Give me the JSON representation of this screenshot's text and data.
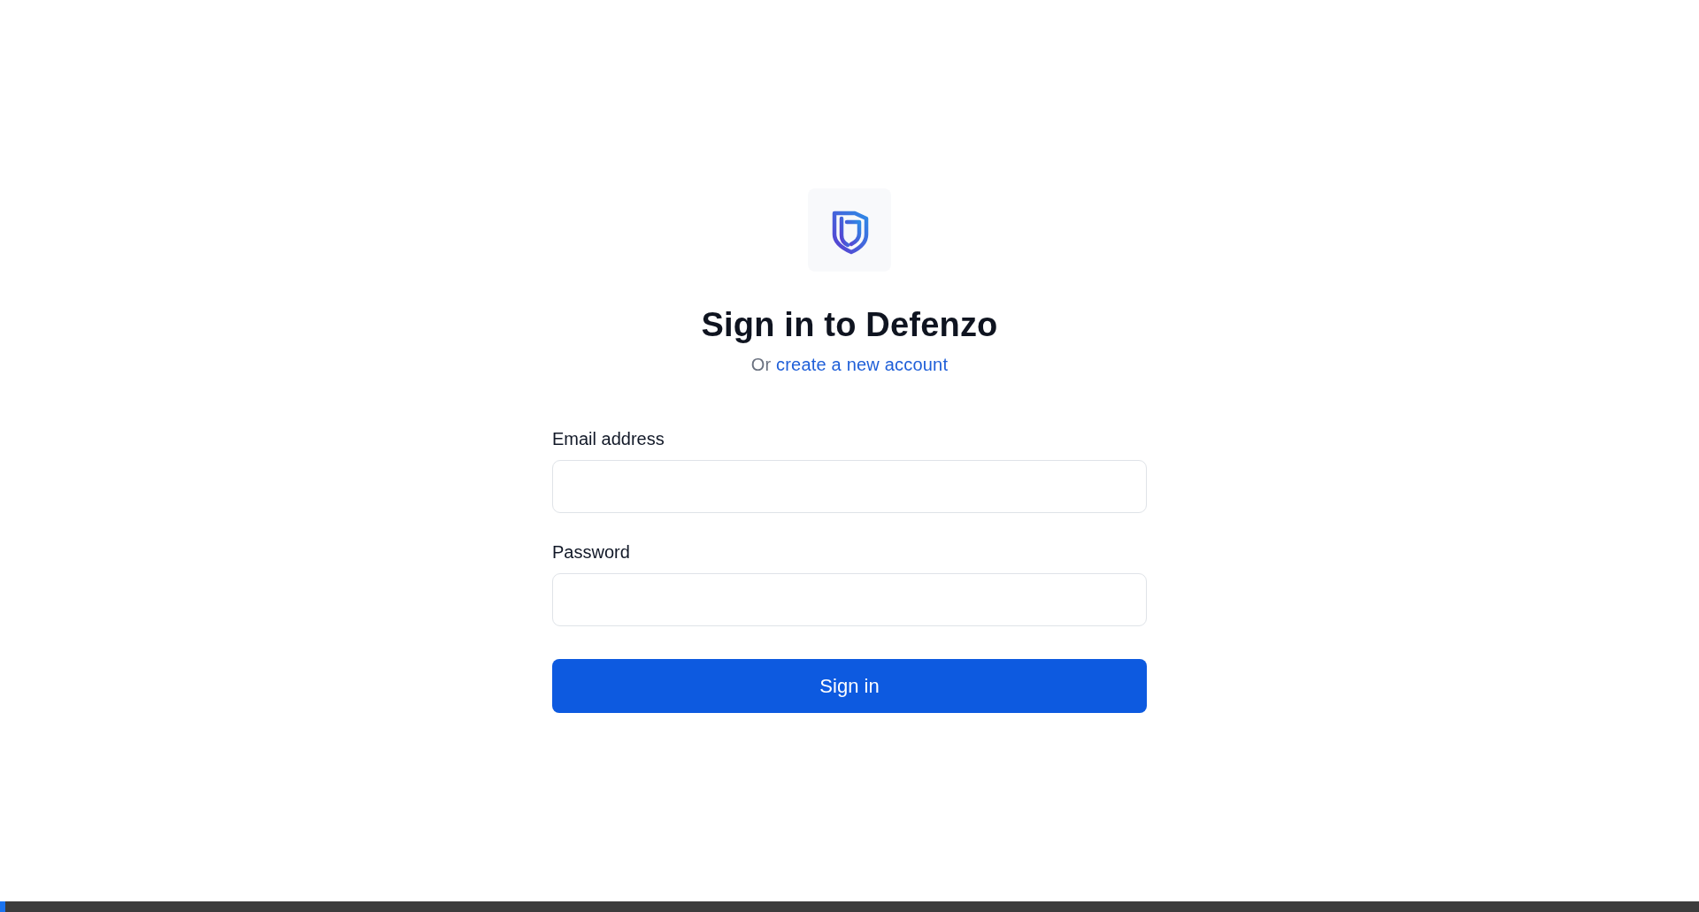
{
  "heading": "Sign in to Defenzo",
  "subtitle": {
    "prefix": "Or",
    "link": "create a new account"
  },
  "fields": [
    {
      "label": "Email address"
    },
    {
      "label": "Password"
    }
  ],
  "submit_button": "Sign in",
  "progress_bar": {
    "level": 0.003
  }
}
